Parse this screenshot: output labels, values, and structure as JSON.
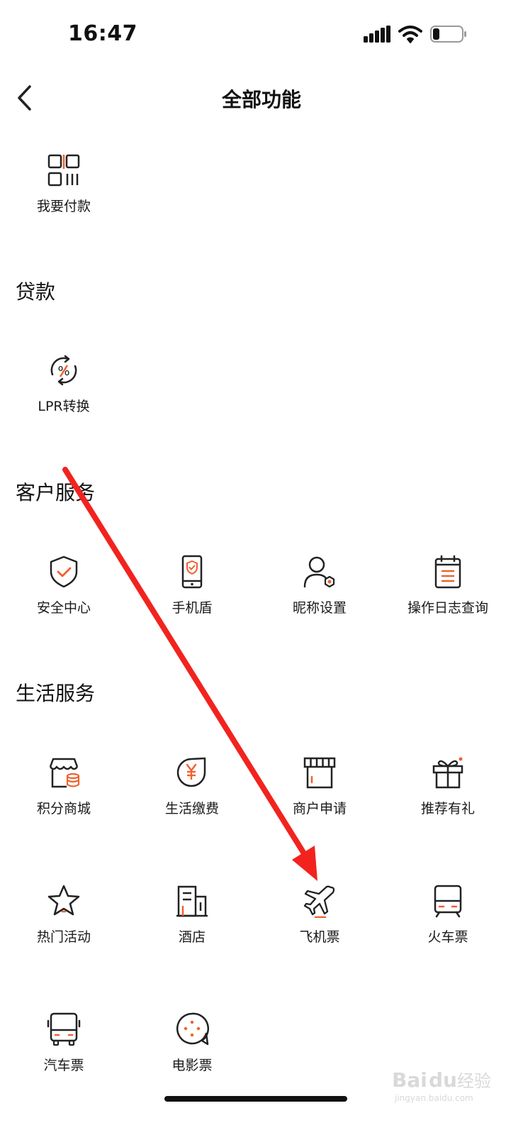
{
  "status_bar": {
    "time": "16:47"
  },
  "header": {
    "title": "全部功能",
    "back_icon": "chevron-left-icon"
  },
  "sections": {
    "pay": {
      "items": [
        {
          "label": "我要付款",
          "icon": "qr-code-icon"
        }
      ]
    },
    "loan": {
      "title": "贷款",
      "items": [
        {
          "label": "LPR转换",
          "icon": "percent-cycle-icon"
        }
      ]
    },
    "customer": {
      "title": "客户服务",
      "items": [
        {
          "label": "安全中心",
          "icon": "shield-check-icon"
        },
        {
          "label": "手机盾",
          "icon": "phone-shield-icon"
        },
        {
          "label": "昵称设置",
          "icon": "user-settings-icon"
        },
        {
          "label": "操作日志查询",
          "icon": "calendar-log-icon"
        }
      ]
    },
    "life": {
      "title": "生活服务",
      "items": [
        {
          "label": "积分商城",
          "icon": "points-store-icon"
        },
        {
          "label": "生活缴费",
          "icon": "yen-bill-icon"
        },
        {
          "label": "商户申请",
          "icon": "storefront-icon"
        },
        {
          "label": "推荐有礼",
          "icon": "gift-icon"
        },
        {
          "label": "热门活动",
          "icon": "star-icon"
        },
        {
          "label": "酒店",
          "icon": "hotel-building-icon"
        },
        {
          "label": "飞机票",
          "icon": "airplane-icon"
        },
        {
          "label": "火车票",
          "icon": "train-icon"
        },
        {
          "label": "汽车票",
          "icon": "bus-icon"
        },
        {
          "label": "电影票",
          "icon": "movie-icon"
        }
      ]
    }
  },
  "watermark": {
    "brand": "Bai",
    "brand_end": "du",
    "cn": "经验",
    "url": "jingyan.baidu.com"
  },
  "colors": {
    "accent": "#F0612E",
    "text": "#111111",
    "arrow": "#F2231F"
  }
}
